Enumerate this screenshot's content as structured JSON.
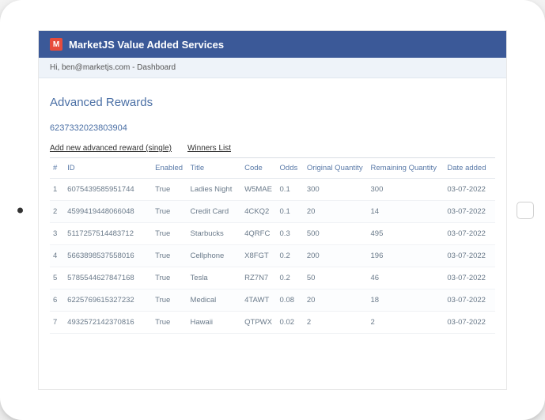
{
  "header": {
    "title": "MarketJS Value Added Services",
    "logo_letter": "M"
  },
  "subbar": {
    "greeting": "Hi, ben@marketjs.com - Dashboard"
  },
  "page": {
    "title": "Advanced Rewards",
    "record_id": "6237332023803904",
    "links": {
      "add_new": "Add new advanced reward (single)",
      "winners": "Winners List"
    }
  },
  "table": {
    "headers": {
      "num": "#",
      "id": "ID",
      "enabled": "Enabled",
      "title": "Title",
      "code": "Code",
      "odds": "Odds",
      "oq": "Original Quantity",
      "rq": "Remaining Quantity",
      "date": "Date added"
    },
    "rows": [
      {
        "num": "1",
        "id": "6075439585951744",
        "enabled": "True",
        "title": "Ladies Night",
        "code": "W5MAE",
        "odds": "0.1",
        "oq": "300",
        "rq": "300",
        "date": "03-07-2022"
      },
      {
        "num": "2",
        "id": "4599419448066048",
        "enabled": "True",
        "title": "Credit Card",
        "code": "4CKQ2",
        "odds": "0.1",
        "oq": "20",
        "rq": "14",
        "date": "03-07-2022"
      },
      {
        "num": "3",
        "id": "5117257514483712",
        "enabled": "True",
        "title": "Starbucks",
        "code": "4QRFC",
        "odds": "0.3",
        "oq": "500",
        "rq": "495",
        "date": "03-07-2022"
      },
      {
        "num": "4",
        "id": "5663898537558016",
        "enabled": "True",
        "title": "Cellphone",
        "code": "X8FGT",
        "odds": "0.2",
        "oq": "200",
        "rq": "196",
        "date": "03-07-2022"
      },
      {
        "num": "5",
        "id": "5785544627847168",
        "enabled": "True",
        "title": "Tesla",
        "code": "RZ7N7",
        "odds": "0.2",
        "oq": "50",
        "rq": "46",
        "date": "03-07-2022"
      },
      {
        "num": "6",
        "id": "6225769615327232",
        "enabled": "True",
        "title": "Medical",
        "code": "4TAWT",
        "odds": "0.08",
        "oq": "20",
        "rq": "18",
        "date": "03-07-2022"
      },
      {
        "num": "7",
        "id": "4932572142370816",
        "enabled": "True",
        "title": "Hawaii",
        "code": "QTPWX",
        "odds": "0.02",
        "oq": "2",
        "rq": "2",
        "date": "03-07-2022"
      }
    ]
  }
}
